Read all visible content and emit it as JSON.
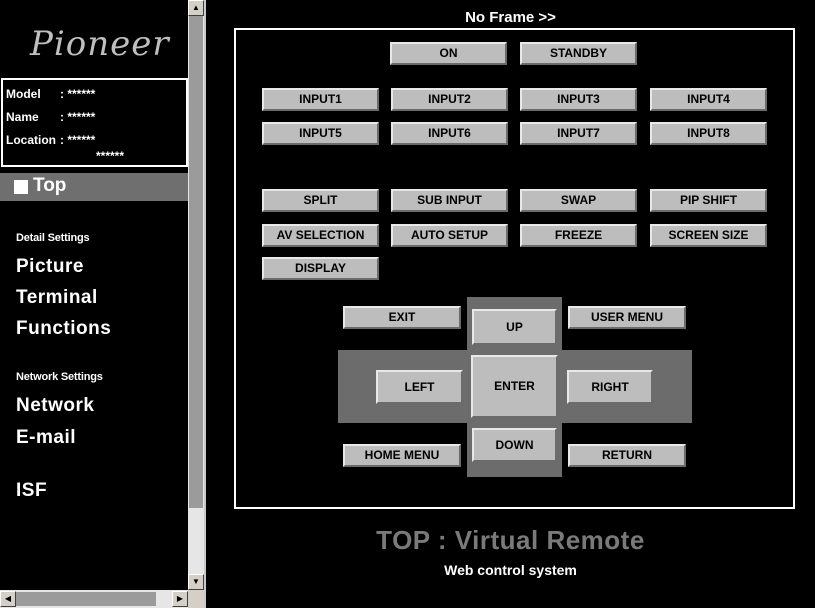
{
  "sidebar": {
    "logo": "Pioneer",
    "info": {
      "model_label": "Model",
      "model_value": ": ******",
      "name_label": "Name",
      "name_value": ": ******",
      "location_label": "Location",
      "location_value": ": ******",
      "location_value2": "******"
    },
    "top_item": "Top",
    "detail_header": "Detail Settings",
    "detail_links": [
      "Picture",
      "Terminal",
      "Functions"
    ],
    "network_header": "Network Settings",
    "network_links": [
      "Network",
      "E-mail"
    ],
    "isf_link": "ISF"
  },
  "main": {
    "frame_link": "No Frame >>",
    "buttons": {
      "on": "ON",
      "standby": "STANDBY",
      "input1": "INPUT1",
      "input2": "INPUT2",
      "input3": "INPUT3",
      "input4": "INPUT4",
      "input5": "INPUT5",
      "input6": "INPUT6",
      "input7": "INPUT7",
      "input8": "INPUT8",
      "split": "SPLIT",
      "sub_input": "SUB INPUT",
      "swap": "SWAP",
      "pip_shift": "PIP SHIFT",
      "av_selection": "AV SELECTION",
      "auto_setup": "AUTO SETUP",
      "freeze": "FREEZE",
      "screen_size": "SCREEN SIZE",
      "display": "DISPLAY"
    },
    "nav": {
      "exit": "EXIT",
      "up": "UP",
      "user_menu": "USER MENU",
      "left": "LEFT",
      "enter": "ENTER",
      "right": "RIGHT",
      "home_menu": "HOME MENU",
      "down": "DOWN",
      "return": "RETURN"
    },
    "title": "TOP : Virtual Remote",
    "subtitle": "Web control system"
  },
  "colors": {
    "background": "#000000",
    "button_face": "#bdbdbd",
    "nav_pad": "#6c6c6c",
    "title_gray": "#7a7a7a",
    "top_highlight": "#6f6f6f"
  },
  "icons": {
    "scroll_up": "arrow-up-icon",
    "scroll_down": "arrow-down-icon",
    "scroll_left": "arrow-left-icon",
    "scroll_right": "arrow-right-icon"
  }
}
